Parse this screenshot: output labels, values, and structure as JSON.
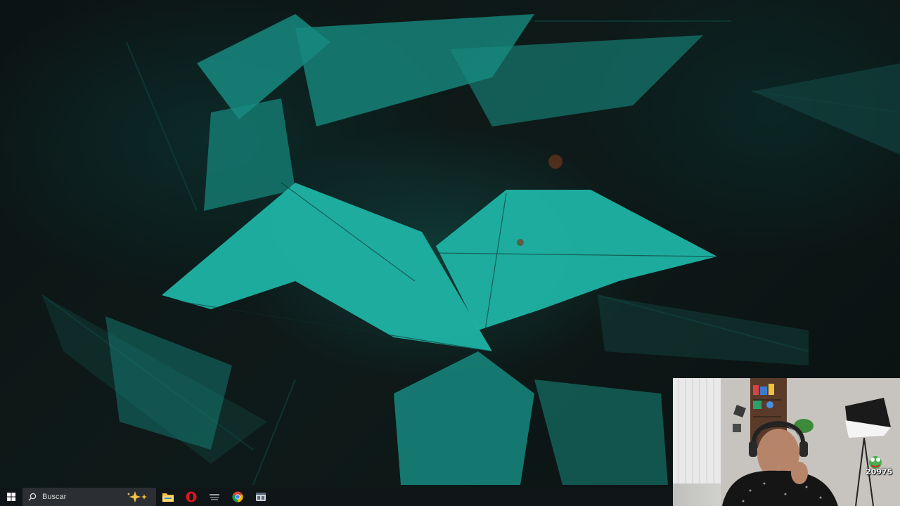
{
  "taskbar": {
    "search_placeholder": "Buscar",
    "apps": [
      {
        "name": "file-explorer-icon"
      },
      {
        "name": "opera-icon"
      },
      {
        "name": "app-icon"
      },
      {
        "name": "chrome-icon"
      },
      {
        "name": "window-app-icon"
      }
    ]
  },
  "overlay": {
    "viewer_count": "20975"
  },
  "colors": {
    "fern": "#1aa89a",
    "taskbar": "#101517",
    "search": "#2b2f33"
  }
}
